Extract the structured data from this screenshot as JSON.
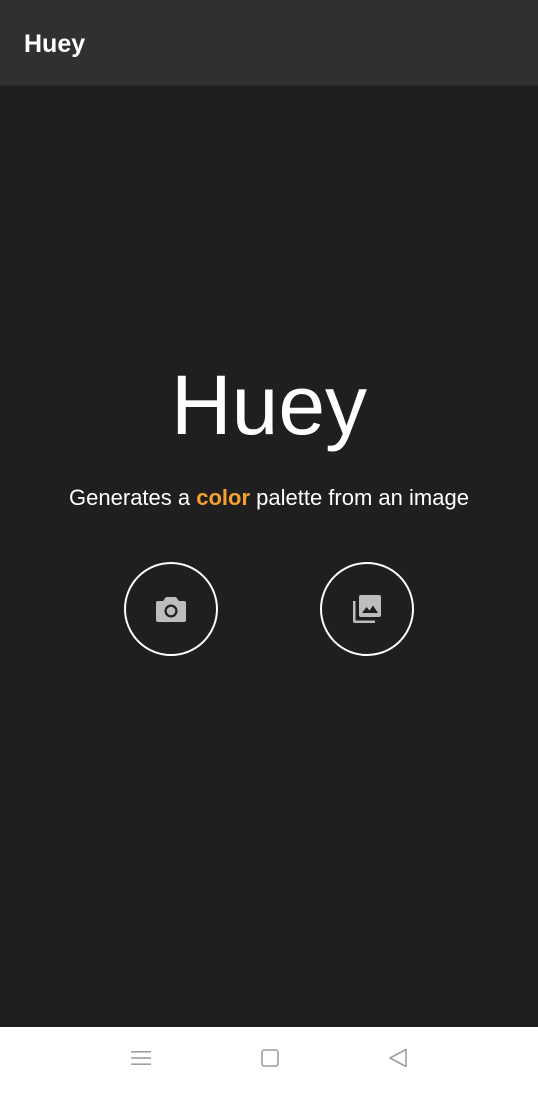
{
  "app_bar": {
    "title": "Huey"
  },
  "main": {
    "hero_title": "Huey",
    "subtitle_before": "Generates a ",
    "subtitle_accent": "color",
    "subtitle_after": " palette from an image",
    "accent_color": "#f7a02c",
    "buttons": [
      {
        "icon": "camera-icon"
      },
      {
        "icon": "gallery-icon"
      }
    ]
  },
  "system_nav": {
    "items": [
      {
        "icon": "menu-icon"
      },
      {
        "icon": "home-square-icon"
      },
      {
        "icon": "back-triangle-icon"
      }
    ]
  }
}
